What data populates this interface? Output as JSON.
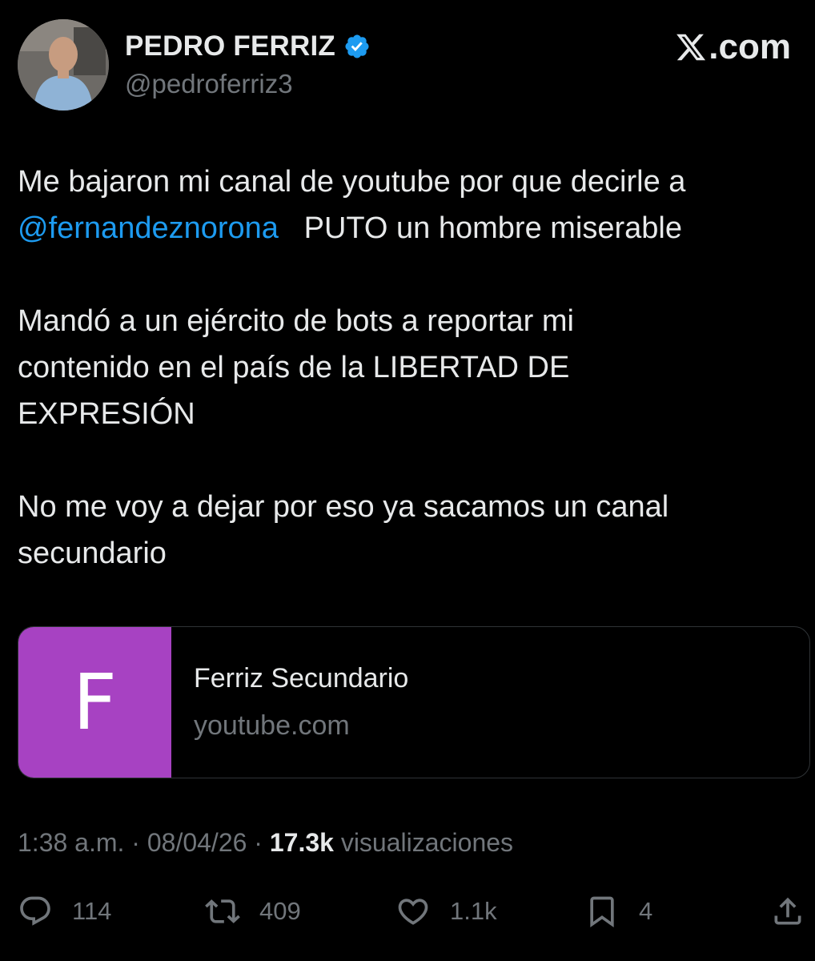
{
  "author": {
    "display_name": "PEDRO FERRIZ",
    "handle": "@pedroferriz3",
    "verified_icon": "verified-badge-icon"
  },
  "brand": {
    "label": ".com",
    "icon": "x-logo-icon"
  },
  "tweet": {
    "para1_text": "Me bajaron mi canal de youtube por que decirle a",
    "para1_mention": "@fernandeznorona",
    "para1_rest": "PUTO un hombre miserable",
    "para2_line1": "Mandó a un ejército de bots a reportar mi",
    "para2_line2": "contenido en el país de la LIBERTAD DE",
    "para2_line3": "EXPRESIÓN",
    "para3_line1": "No me voy a dejar por eso ya sacamos un canal",
    "para3_line2": "secundario"
  },
  "link_card": {
    "thumb_letter": "F",
    "title": "Ferriz Secundario",
    "domain": "youtube.com",
    "thumb_color": "#a742c2"
  },
  "meta": {
    "time": "1:38 a.m.",
    "separator": "·",
    "date": "08/04/26",
    "views_count": "17.3k",
    "views_label": "visualizaciones"
  },
  "actions": {
    "replies": "114",
    "reposts": "409",
    "likes": "1.1k",
    "bookmarks": "4"
  },
  "colors": {
    "background": "#000000",
    "text": "#e7e9ea",
    "secondary": "#71767b",
    "link": "#1d9bf0",
    "verified": "#1d9bf0"
  }
}
